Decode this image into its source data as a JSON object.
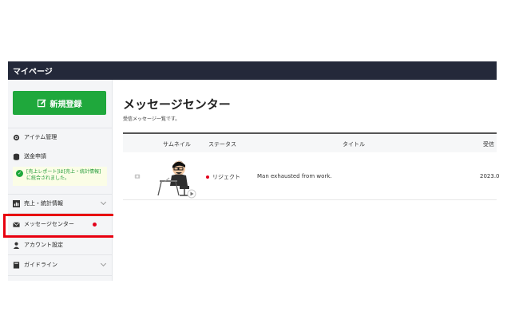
{
  "header": {
    "title": "マイページ"
  },
  "sidebar": {
    "new_button_label": "新規登録",
    "items": [
      {
        "label": "アイテム管理",
        "icon": "gear-icon"
      },
      {
        "label": "送金申請",
        "icon": "database-icon"
      },
      {
        "label": "売上・統計情報",
        "icon": "bar-chart-icon"
      },
      {
        "label": "メッセージセンター",
        "icon": "mail-icon"
      },
      {
        "label": "アカウント設定",
        "icon": "person-icon"
      },
      {
        "label": "ガイドライン",
        "icon": "book-icon"
      }
    ],
    "notice": "[売上レポート]は[売上・統計情報]に統合されました。"
  },
  "main": {
    "title": "メッセージセンター",
    "subtitle": "受信メッセージ一覧です。",
    "columns": {
      "thumbnail": "サムネイル",
      "status": "ステータス",
      "title": "タイトル",
      "date": "受信"
    },
    "rows": [
      {
        "status": "リジェクト",
        "title": "Man exhausted from work.",
        "date": "2023.0"
      }
    ]
  },
  "colors": {
    "accent_green": "#1fa83c",
    "header_navy": "#24293a",
    "reject_red": "#e3001b",
    "highlight_red": "#e8000f"
  }
}
